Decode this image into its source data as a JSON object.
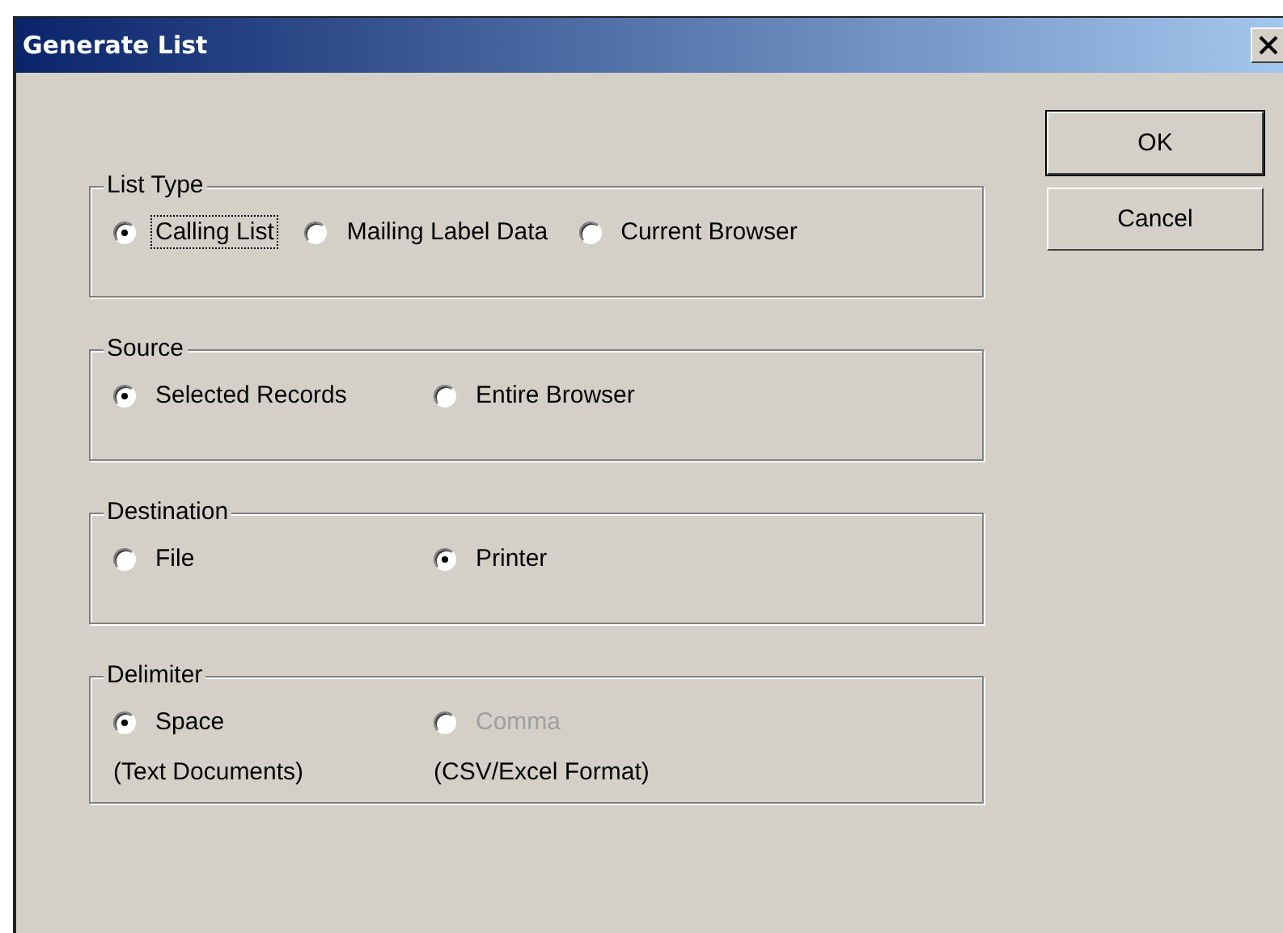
{
  "window": {
    "title": "Generate List"
  },
  "groups": [
    {
      "label": "List Type",
      "options": [
        {
          "label": "Calling List",
          "selected": true,
          "focused": true,
          "disabled": false
        },
        {
          "label": "Mailing Label Data",
          "selected": false,
          "focused": false,
          "disabled": false
        },
        {
          "label": "Current Browser",
          "selected": false,
          "focused": false,
          "disabled": false
        }
      ]
    },
    {
      "label": "Source",
      "options": [
        {
          "label": "Selected Records",
          "selected": true,
          "focused": false,
          "disabled": false
        },
        {
          "label": "Entire Browser",
          "selected": false,
          "focused": false,
          "disabled": false
        }
      ]
    },
    {
      "label": "Destination",
      "options": [
        {
          "label": "File",
          "selected": false,
          "focused": false,
          "disabled": false
        },
        {
          "label": "Printer",
          "selected": true,
          "focused": false,
          "disabled": false
        }
      ]
    },
    {
      "label": "Delimiter",
      "options": [
        {
          "label": "Space",
          "selected": true,
          "focused": false,
          "disabled": false,
          "note": "(Text Documents)"
        },
        {
          "label": "Comma",
          "selected": false,
          "focused": false,
          "disabled": true,
          "note": "(CSV/Excel Format)"
        }
      ]
    }
  ],
  "buttons": [
    {
      "label": "OK",
      "default": true
    },
    {
      "label": "Cancel",
      "default": false
    }
  ]
}
